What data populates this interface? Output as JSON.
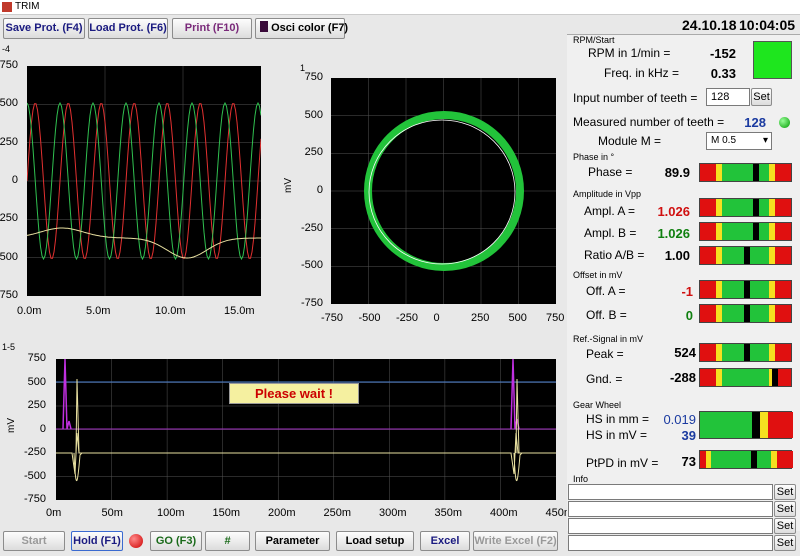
{
  "window": {
    "title": "TRIM"
  },
  "toolbar": {
    "save_label": "Save Prot. (F4)",
    "load_label": "Load Prot. (F6)",
    "print_label": "Print (F10)",
    "osci_label": "Osci color (F7)"
  },
  "header": {
    "date": "24.10.18",
    "time": "10:04:05"
  },
  "plot_top_left": {
    "exp": "-4",
    "y_ticks": [
      "750",
      "500",
      "250",
      "0",
      "-250",
      "-500",
      "-750"
    ],
    "x_ticks": [
      "0.0m",
      "5.0m",
      "10.0m",
      "15.0m"
    ]
  },
  "plot_top_right": {
    "exp": "1",
    "y_ticks": [
      "750",
      "500",
      "250",
      "0",
      "-250",
      "-500",
      "-750"
    ],
    "x_ticks": [
      "-750",
      "-500",
      "-250",
      "0",
      "250",
      "500",
      "750"
    ],
    "ylabel": "mV"
  },
  "plot_bottom": {
    "exp": "1-5",
    "y_ticks": [
      "750",
      "500",
      "250",
      "0",
      "-250",
      "-500",
      "-750"
    ],
    "x_ticks": [
      "0m",
      "50m",
      "100m",
      "150m",
      "200m",
      "250m",
      "300m",
      "350m",
      "400m",
      "450m"
    ],
    "ylabel": "mV",
    "wait_message": "Please wait !"
  },
  "rpm": {
    "section": "RPM/Start",
    "rpm_label": "RPM in 1/min =",
    "rpm_value": "-152",
    "freq_label": "Freq. in kHz =",
    "freq_value": "0.33",
    "status_color": "#1ee61e"
  },
  "teeth": {
    "input_label": "Input number of teeth =",
    "input_value": "128",
    "set_label": "Set",
    "measured_label": "Measured number of teeth =",
    "measured_value": "128",
    "module_label": "Module M =",
    "module_value": "M 0.5"
  },
  "phase": {
    "section": "Phase in °",
    "label": "Phase =",
    "value": "89.9",
    "level": 0.62
  },
  "amplitude": {
    "section": "Amplitude in Vpp",
    "a_label": "Ampl. A =",
    "a_value": "1.026",
    "a_level": 0.62,
    "b_label": "Ampl. B =",
    "b_value": "1.026",
    "b_level": 0.62,
    "ratio_label": "Ratio A/B =",
    "ratio_value": "1.00",
    "ratio_level": 0.52
  },
  "offset": {
    "section": "Offset in mV",
    "a_label": "Off. A =",
    "a_value": "-1",
    "a_level": 0.52,
    "b_label": "Off. B =",
    "b_value": "0",
    "b_level": 0.52
  },
  "ref": {
    "section": "Ref.-Signal in mV",
    "peak_label": "Peak =",
    "peak_value": "524",
    "peak_level": 0.52,
    "gnd_label": "Gnd. =",
    "gnd_value": "-288",
    "gnd_level": 0.82
  },
  "gear": {
    "section": "Gear Wheel",
    "hs_mm_label": "HS in mm =",
    "hs_mm_value": "0.019",
    "hs_mv_label": "HS in mV =",
    "hs_mv_value": "39",
    "ptpd_label": "PtPD in mV =",
    "ptpd_value": "73"
  },
  "info": {
    "section": "Info",
    "set_label": "Set"
  },
  "bottom": {
    "start": "Start",
    "hold": "Hold (F1)",
    "go": "GO (F3)",
    "hash": "#",
    "parameter": "Parameter",
    "load_setup": "Load setup",
    "excel": "Excel",
    "write_excel": "Write Excel (F2)"
  },
  "colors": {
    "green": "#22c33a",
    "red": "#e01010",
    "navy": "#1a1a80",
    "value_red": "#d01010",
    "value_green": "#108010",
    "value_blue": "#1a3aa0"
  }
}
